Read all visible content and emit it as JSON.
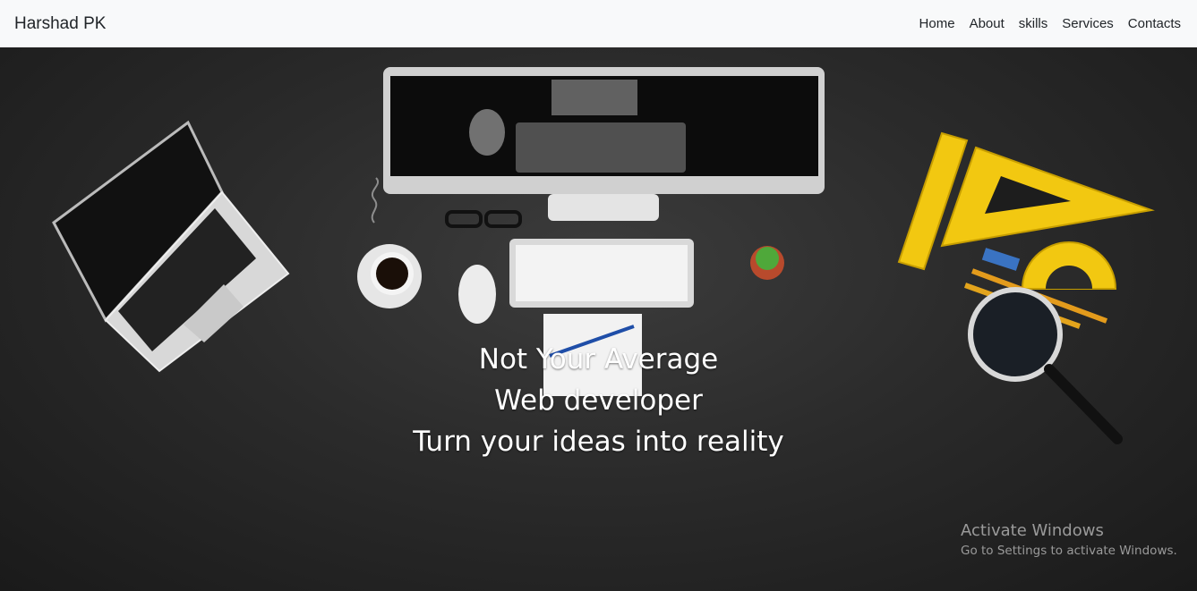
{
  "navbar": {
    "brand": "Harshad PK",
    "links": [
      {
        "label": "Home"
      },
      {
        "label": "About"
      },
      {
        "label": "skills"
      },
      {
        "label": "Services"
      },
      {
        "label": "Contacts"
      }
    ]
  },
  "hero": {
    "lines": [
      "Not Your Average",
      "Web developer",
      "Turn your ideas into reality"
    ]
  },
  "watermark": {
    "title": "Activate Windows",
    "subtitle": "Go to Settings to activate Windows."
  },
  "colors": {
    "navbar_bg": "#f8f9fa",
    "hero_bg": "#2b2b2b",
    "text_light": "#ffffff",
    "ruler_yellow": "#f2c811"
  }
}
